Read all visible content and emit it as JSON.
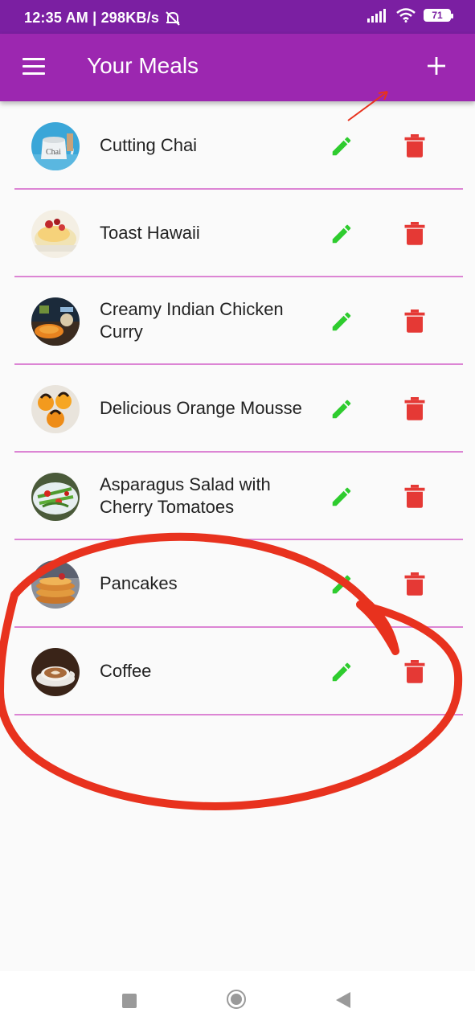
{
  "status_bar": {
    "time_speed": "12:35 AM | 298KB/s",
    "battery": "71"
  },
  "app_bar": {
    "title": "Your Meals",
    "menu_icon": "hamburger-menu-icon",
    "add_icon": "plus-icon"
  },
  "meals": [
    {
      "name": "Cutting Chai"
    },
    {
      "name": "Toast Hawaii"
    },
    {
      "name": "Creamy Indian Chicken Curry"
    },
    {
      "name": "Delicious Orange Mousse"
    },
    {
      "name": "Asparagus Salad with Cherry Tomatoes"
    },
    {
      "name": "Pancakes"
    },
    {
      "name": "Coffee"
    }
  ],
  "colors": {
    "status_bar": "#7b1fa2",
    "app_bar": "#9c27b0",
    "edit_icon": "#2ecc2e",
    "delete_icon": "#e53935",
    "divider": "#dc85d4",
    "annotation": "#e8321e"
  }
}
